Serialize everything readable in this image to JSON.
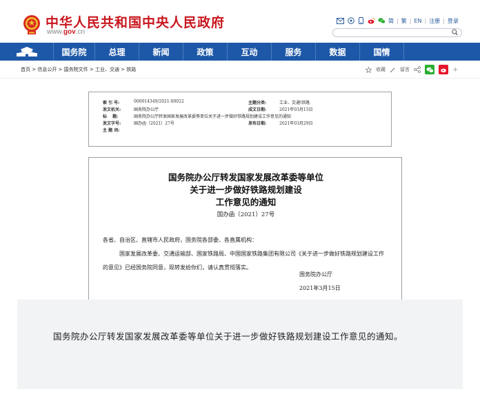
{
  "header": {
    "site_title": "中华人民共和国中央人民政府",
    "site_domain_prefix": "www.",
    "site_domain_brand": "gov",
    "site_domain_suffix": ".cn",
    "toolbar_links": [
      "简",
      "繁",
      "EN",
      "注册",
      "登录"
    ],
    "search_placeholder": ""
  },
  "nav": {
    "items": [
      "国务院",
      "总理",
      "新闻",
      "政策",
      "互动",
      "服务",
      "数据",
      "国情"
    ]
  },
  "breadcrumb": "首页 > 信息公开 > 国务院文件 > 工业、交通 > 铁路",
  "share": {
    "favorite": "收藏",
    "comment": "留言"
  },
  "meta": {
    "index_no_label": "索 引 号:",
    "index_no": "000014349/2021-00022",
    "topic_label": "主题分类:",
    "topic": "工业、交通\\铁路",
    "issuer_label": "发文机关:",
    "issuer": "国务院办公厅",
    "created_label": "成文日期:",
    "created": "2021年03月15日",
    "title_label": "标　 题:",
    "title": "国务院办公厅转发国家发展改革委等单位关于进一步做好铁路规划建设工作意见的通知",
    "doc_no_label": "发文字号:",
    "doc_no": "国办函〔2021〕27号",
    "published_label": "发布日期:",
    "published": "2021年03月29日",
    "keywords_label": "主 题 词:"
  },
  "document": {
    "title_line1": "国务院办公厅转发国家发展改革委等单位",
    "title_line2": "关于进一步做好铁路规划建设",
    "title_line3": "工作意见的通知",
    "number": "国办函〔2021〕27号",
    "addressee": "各省、自治区、直辖市人民政府，国务院各部委、各直属机构：",
    "body": "国家发展改革委、交通运输部、国家铁路局、中国国家铁路集团有限公司《关于进一步做好铁路规划建设工作的意见》已经国务院同意，现转发给你们，请认真贯彻落实。",
    "sign_org": "国务院办公厅",
    "sign_date": "2021年3月15日"
  },
  "caption": "国务院办公厅转发国家发展改革委等单位关于进一步做好铁路规划建设工作意见的通知。",
  "colors": {
    "brand_red": "#c8161d",
    "nav_blue": "#1d58a8",
    "panel_bg": "#f2f3f5"
  }
}
